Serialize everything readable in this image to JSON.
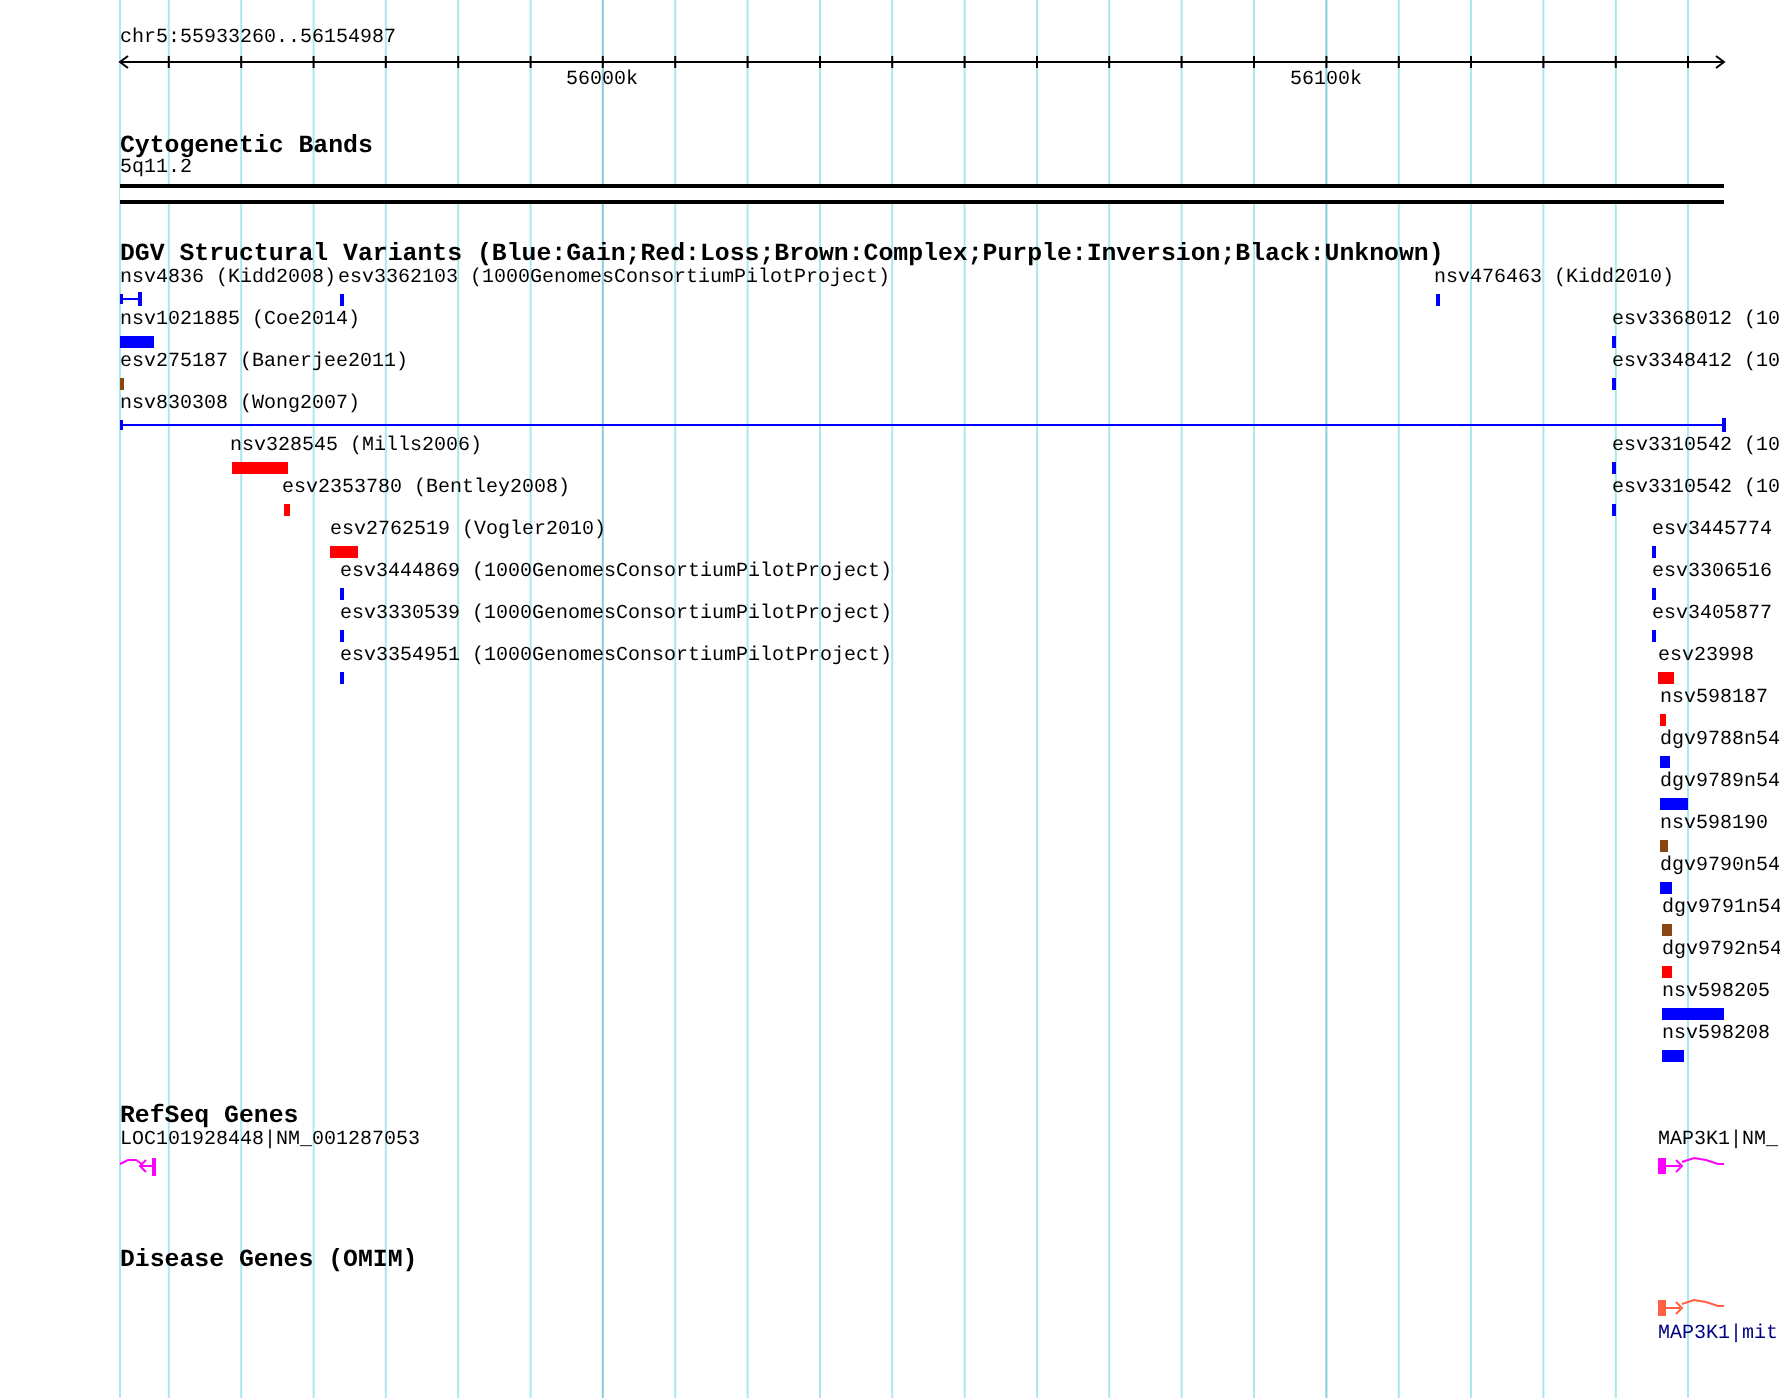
{
  "ruler": {
    "region": "chr5:55933260..56154987",
    "ticks": [
      {
        "label": "56000k"
      },
      {
        "label": "56100k"
      }
    ]
  },
  "tracks": [
    {
      "kind": "cytoband",
      "title": "Cytogenetic Bands",
      "band": "5q11.2"
    },
    {
      "kind": "variants",
      "title": "DGV Structural Variants (Blue:Gain;Red:Loss;Brown:Complex;Purple:Inversion;Black:Unknown)",
      "features": [
        {
          "label": "nsv4836 (Kidd2008)",
          "color": "#0000ff",
          "kind": "span"
        },
        {
          "label": "esv3362103 (1000GenomesConsortiumPilotProject)",
          "color": "#0000ff",
          "kind": "block"
        },
        {
          "label": "nsv476463 (Kidd2010)",
          "color": "#0000ff",
          "kind": "block"
        },
        {
          "label": "nsv1021885 (Coe2014)",
          "color": "#0000ff",
          "kind": "block"
        },
        {
          "label": "esv3368012 (10",
          "color": "#0000ff",
          "kind": "block"
        },
        {
          "label": "esv275187 (Banerjee2011)",
          "color": "#8b4513",
          "kind": "block"
        },
        {
          "label": "esv3348412 (10",
          "color": "#0000ff",
          "kind": "block"
        },
        {
          "label": "nsv830308 (Wong2007)",
          "color": "#0000ff",
          "kind": "span"
        },
        {
          "label": "nsv328545 (Mills2006)",
          "color": "#ff0000",
          "kind": "block"
        },
        {
          "label": "esv3310542 (10",
          "color": "#0000ff",
          "kind": "block"
        },
        {
          "label": "esv2353780 (Bentley2008)",
          "color": "#ff0000",
          "kind": "block"
        },
        {
          "label": "esv3310542 (10",
          "color": "#0000ff",
          "kind": "block"
        },
        {
          "label": "esv2762519 (Vogler2010)",
          "color": "#ff0000",
          "kind": "block"
        },
        {
          "label": "esv3445774",
          "color": "#0000ff",
          "kind": "block"
        },
        {
          "label": "esv3444869 (1000GenomesConsortiumPilotProject)",
          "color": "#0000ff",
          "kind": "block"
        },
        {
          "label": "esv3306516",
          "color": "#0000ff",
          "kind": "block"
        },
        {
          "label": "esv3330539 (1000GenomesConsortiumPilotProject)",
          "color": "#0000ff",
          "kind": "block"
        },
        {
          "label": "esv3405877",
          "color": "#0000ff",
          "kind": "block"
        },
        {
          "label": "esv3354951 (1000GenomesConsortiumPilotProject)",
          "color": "#0000ff",
          "kind": "block"
        },
        {
          "label": "esv23998",
          "color": "#ff0000",
          "kind": "block"
        },
        {
          "label": "nsv598187",
          "color": "#ff0000",
          "kind": "block"
        },
        {
          "label": "dgv9788n54",
          "color": "#0000ff",
          "kind": "block"
        },
        {
          "label": "dgv9789n54",
          "color": "#0000ff",
          "kind": "block"
        },
        {
          "label": "nsv598190",
          "color": "#8b4513",
          "kind": "block"
        },
        {
          "label": "dgv9790n54",
          "color": "#0000ff",
          "kind": "block"
        },
        {
          "label": "dgv9791n54",
          "color": "#8b4513",
          "kind": "block"
        },
        {
          "label": "dgv9792n54",
          "color": "#ff0000",
          "kind": "block"
        },
        {
          "label": "nsv598205",
          "color": "#0000ff",
          "kind": "block"
        },
        {
          "label": "nsv598208",
          "color": "#0000ff",
          "kind": "block"
        }
      ]
    },
    {
      "kind": "genes",
      "title": "RefSeq Genes",
      "features": [
        {
          "label": "LOC101928448|NM_001287053",
          "kind": "reverse"
        },
        {
          "label": "MAP3K1|NM_",
          "kind": "forward"
        }
      ]
    },
    {
      "kind": "disease",
      "title": "Disease Genes (OMIM)",
      "features": [
        {
          "label": "MAP3K1|mit",
          "kind": "forward"
        }
      ]
    }
  ]
}
